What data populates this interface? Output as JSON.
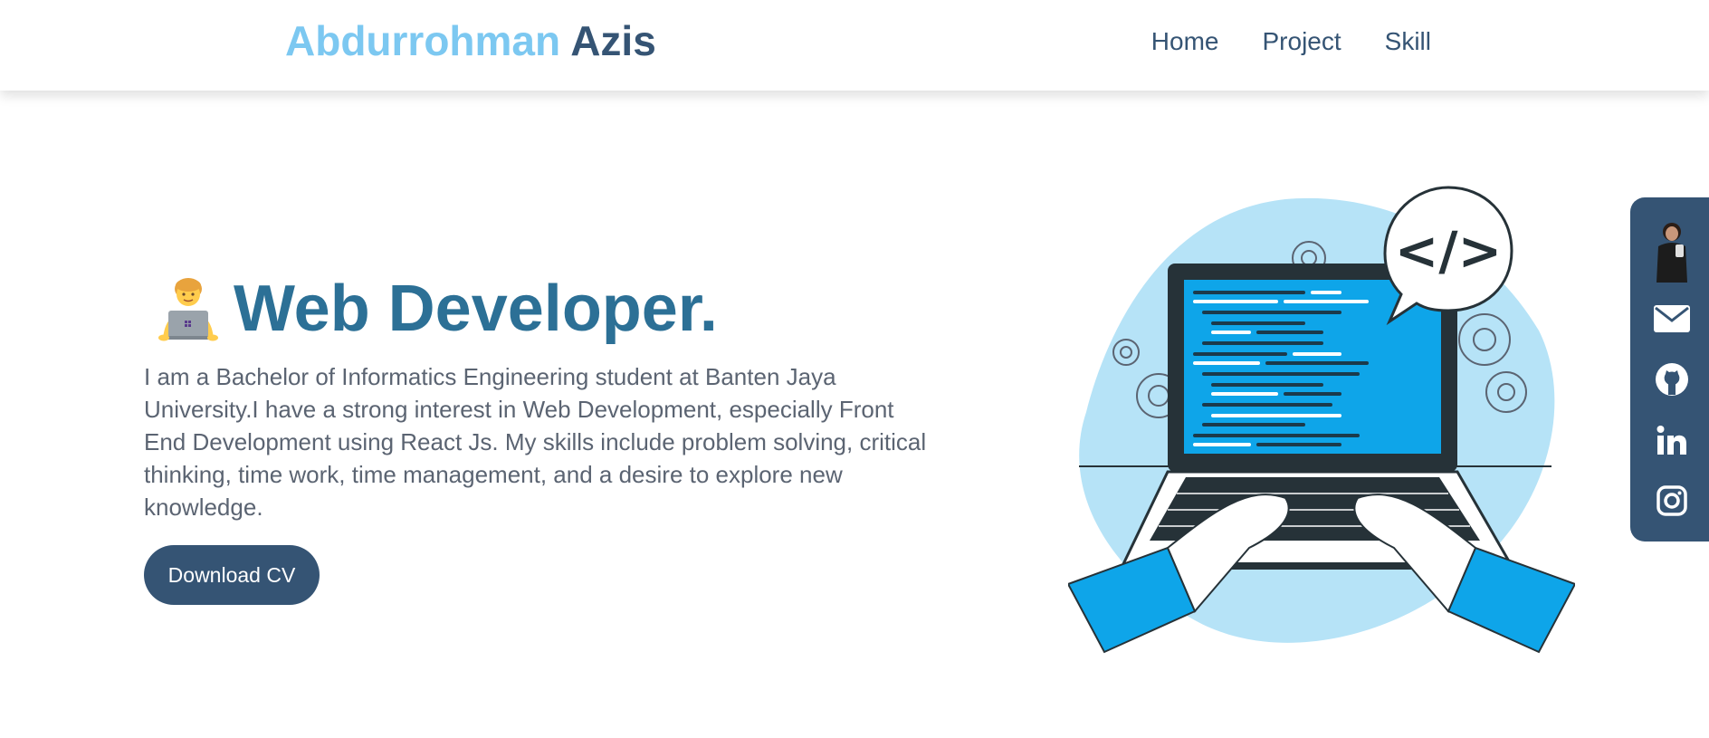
{
  "header": {
    "brand_first": "Abdurrohman",
    "brand_last": "Azis",
    "nav": [
      {
        "label": "Home"
      },
      {
        "label": "Project"
      },
      {
        "label": "Skill"
      }
    ]
  },
  "hero": {
    "emoji_icon": "technologist-emoji-icon",
    "title": "Web Developer.",
    "description": "I am a Bachelor of Informatics Engineering student at Banten Jaya University.I have a strong interest in Web Development, especially Front End Development using React Js. My skills include problem solving, critical thinking, time work, time management, and a desire to explore new knowledge.",
    "button_label": "Download CV",
    "illustration_icon": "developer-laptop-illustration",
    "code_bubble_text": "</>"
  },
  "social": {
    "items": [
      {
        "icon": "avatar"
      },
      {
        "icon": "mail-icon"
      },
      {
        "icon": "github-icon"
      },
      {
        "icon": "linkedin-icon"
      },
      {
        "icon": "instagram-icon"
      }
    ]
  },
  "colors": {
    "brand_light": "#7cc8f1",
    "brand_dark": "#355474",
    "title": "#2c7096",
    "text": "#5b6472",
    "accent": "#0ea5e9"
  }
}
